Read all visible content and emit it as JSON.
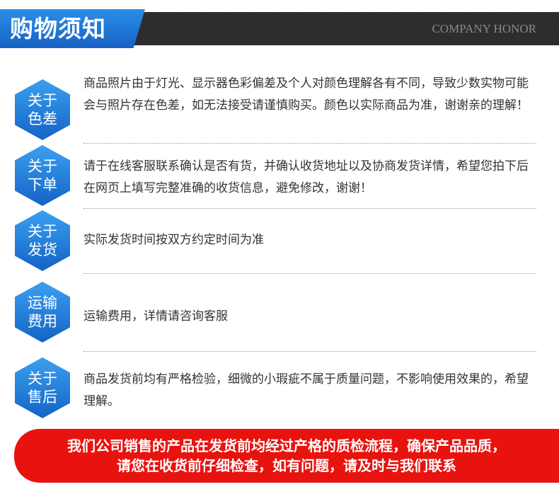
{
  "header": {
    "title": "购物须知",
    "subtitle": "COMPANY HONOR"
  },
  "items": [
    {
      "badge_line1": "关于",
      "badge_line2": "色差",
      "text": "商品照片由于灯光、显示器色彩偏差及个人对颜色理解各有不同，导致少数实物可能会与照片存在色差，如无法接受请谨慎购买。颜色以实际商品为准，谢谢亲的理解！"
    },
    {
      "badge_line1": "关于",
      "badge_line2": "下单",
      "text": "请于在线客服联系确认是否有货，并确认收货地址以及协商发货详情，希望您拍下后在网页上填写完整准确的收货信息，避免修改，谢谢！"
    },
    {
      "badge_line1": "关于",
      "badge_line2": "发货",
      "text": "实际发货时间按双方约定时间为准"
    },
    {
      "badge_line1": "运输",
      "badge_line2": "费用",
      "text": "运输费用，详情请咨询客服"
    },
    {
      "badge_line1": "关于",
      "badge_line2": "售后",
      "text": "商品发货前均有严格检验，细微的小瑕疵不属于质量问题，不影响使用效果的，希望理解。"
    }
  ],
  "banner": {
    "line1": "我们公司销售的产品在发货前均经过产格的质检流程，确保产品品质，",
    "line2": "请您在收货前仔细检查，如有问题，请及时与我们联系"
  },
  "colors": {
    "accent_blue": "#1a72d6",
    "banner_red": "#e8130f",
    "header_dark": "#2b2b2b"
  }
}
